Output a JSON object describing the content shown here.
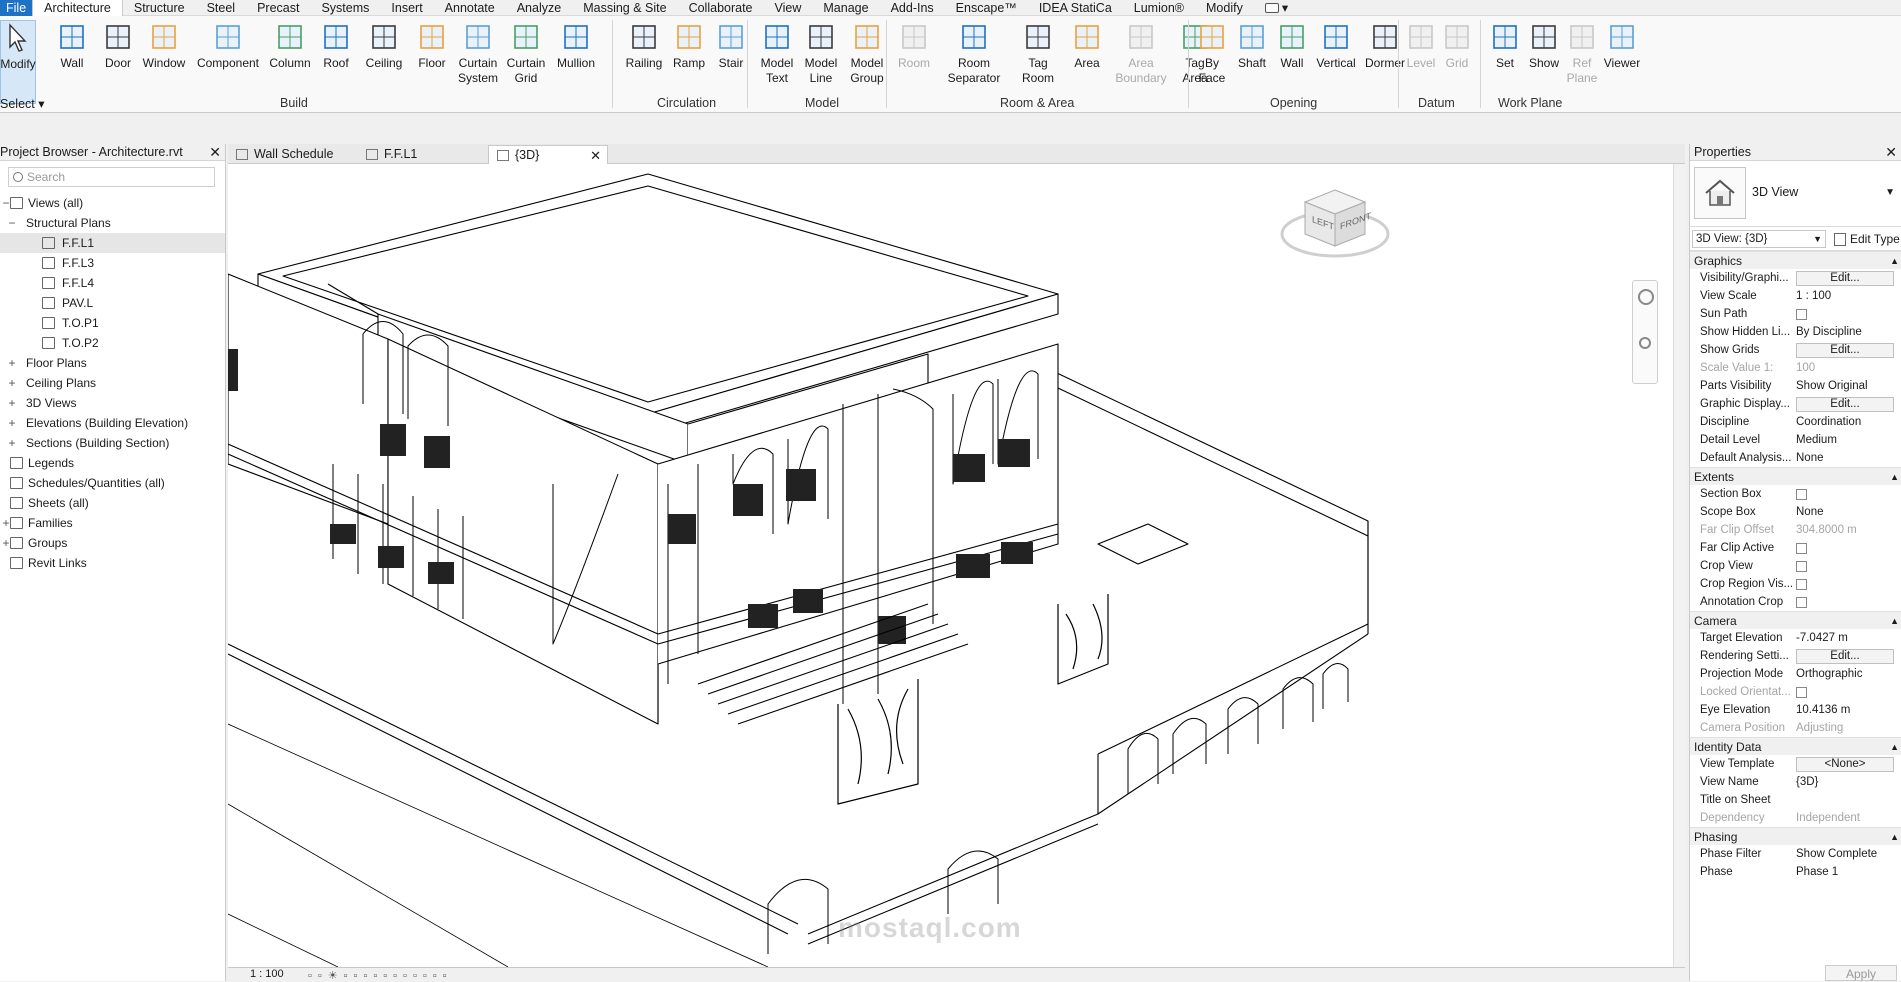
{
  "tabs": [
    "File",
    "Architecture",
    "Structure",
    "Steel",
    "Precast",
    "Systems",
    "Insert",
    "Annotate",
    "Analyze",
    "Massing & Site",
    "Collaborate",
    "View",
    "Manage",
    "Add-Ins",
    "Enscape™",
    "IDEA StatiCa",
    "Lumion®",
    "Modify"
  ],
  "active_tab": "Architecture",
  "ribbon": {
    "modify": "Modify",
    "select": "Select",
    "build": {
      "label": "Build",
      "tools": [
        "Wall",
        "Door",
        "Window",
        "Component",
        "Column",
        "Roof",
        "Ceiling",
        "Floor",
        "Curtain System",
        "Curtain Grid",
        "Mullion"
      ]
    },
    "circulation": {
      "label": "Circulation",
      "tools": [
        "Railing",
        "Ramp",
        "Stair"
      ]
    },
    "model": {
      "label": "Model",
      "tools": [
        "Model Text",
        "Model Line",
        "Model Group"
      ]
    },
    "room_area": {
      "label": "Room & Area",
      "tools": [
        "Room",
        "Room Separator",
        "Tag Room",
        "Area",
        "Area Boundary",
        "Tag Area"
      ]
    },
    "opening": {
      "label": "Opening",
      "tools": [
        "By Face",
        "Shaft",
        "Wall",
        "Vertical",
        "Dormer"
      ]
    },
    "datum": {
      "label": "Datum",
      "tools": [
        "Level",
        "Grid"
      ]
    },
    "work_plane": {
      "label": "Work Plane",
      "tools": [
        "Set",
        "Show",
        "Ref Plane",
        "Viewer"
      ]
    }
  },
  "browser": {
    "title": "Project Browser - Architecture.rvt",
    "search_placeholder": "Search",
    "items": [
      {
        "label": "Views (all)",
        "exp": "−",
        "indent": 0
      },
      {
        "label": "Structural Plans",
        "exp": "−",
        "indent": 1
      },
      {
        "label": "F.F.L1",
        "exp": "",
        "indent": 2,
        "selected": true
      },
      {
        "label": "F.F.L3",
        "exp": "",
        "indent": 2
      },
      {
        "label": "F.F.L4",
        "exp": "",
        "indent": 2
      },
      {
        "label": "PAV.L",
        "exp": "",
        "indent": 2
      },
      {
        "label": "T.O.P1",
        "exp": "",
        "indent": 2
      },
      {
        "label": "T.O.P2",
        "exp": "",
        "indent": 2
      },
      {
        "label": "Floor Plans",
        "exp": "+",
        "indent": 1
      },
      {
        "label": "Ceiling Plans",
        "exp": "+",
        "indent": 1
      },
      {
        "label": "3D Views",
        "exp": "+",
        "indent": 1
      },
      {
        "label": "Elevations (Building Elevation)",
        "exp": "+",
        "indent": 1
      },
      {
        "label": "Sections (Building Section)",
        "exp": "+",
        "indent": 1
      },
      {
        "label": "Legends",
        "exp": "",
        "indent": 0
      },
      {
        "label": "Schedules/Quantities (all)",
        "exp": "",
        "indent": 0
      },
      {
        "label": "Sheets (all)",
        "exp": "",
        "indent": 0
      },
      {
        "label": "Families",
        "exp": "+",
        "indent": 0
      },
      {
        "label": "Groups",
        "exp": "+",
        "indent": 0
      },
      {
        "label": "Revit Links",
        "exp": "",
        "indent": 0
      }
    ]
  },
  "view_tabs": [
    "Wall Schedule",
    "F.F.L1",
    "{3D}"
  ],
  "active_view": "{3D}",
  "view_scale": "1 : 100",
  "viewcube": {
    "left": "LEFT",
    "front": "FRONT"
  },
  "watermark": "mostaql.com",
  "properties": {
    "title": "Properties",
    "type_name": "3D View",
    "filter": "3D View: {3D}",
    "edit_type": "Edit Type",
    "apply": "Apply",
    "groups": [
      {
        "name": "Graphics",
        "rows": [
          {
            "n": "Visibility/Graphi...",
            "v": "Edit...",
            "kind": "button"
          },
          {
            "n": "View Scale",
            "v": "1 : 100"
          },
          {
            "n": "Sun Path",
            "v": "",
            "kind": "check"
          },
          {
            "n": "Show Hidden Li...",
            "v": "By Discipline"
          },
          {
            "n": "Show Grids",
            "v": "Edit...",
            "kind": "button"
          },
          {
            "n": "Scale Value    1:",
            "v": "100",
            "dis": true
          },
          {
            "n": "Parts Visibility",
            "v": "Show Original"
          },
          {
            "n": "Graphic Display...",
            "v": "Edit...",
            "kind": "button"
          },
          {
            "n": "Discipline",
            "v": "Coordination"
          },
          {
            "n": "Detail Level",
            "v": "Medium"
          },
          {
            "n": "Default Analysis...",
            "v": "None"
          }
        ]
      },
      {
        "name": "Extents",
        "rows": [
          {
            "n": "Section Box",
            "v": "",
            "kind": "check"
          },
          {
            "n": "Scope Box",
            "v": "None"
          },
          {
            "n": "Far Clip Offset",
            "v": "304.8000 m",
            "dis": true
          },
          {
            "n": "Far Clip Active",
            "v": "",
            "kind": "check"
          },
          {
            "n": "Crop View",
            "v": "",
            "kind": "check"
          },
          {
            "n": "Crop Region Vis...",
            "v": "",
            "kind": "check"
          },
          {
            "n": "Annotation Crop",
            "v": "",
            "kind": "check"
          }
        ]
      },
      {
        "name": "Camera",
        "rows": [
          {
            "n": "Target Elevation",
            "v": "-7.0427 m"
          },
          {
            "n": "Rendering Setti...",
            "v": "Edit...",
            "kind": "button"
          },
          {
            "n": "Projection Mode",
            "v": "Orthographic"
          },
          {
            "n": "Locked Orientat...",
            "v": "",
            "kind": "check",
            "dis": true
          },
          {
            "n": "Eye Elevation",
            "v": "10.4136 m"
          },
          {
            "n": "Camera Position",
            "v": "Adjusting",
            "dis": true
          }
        ]
      },
      {
        "name": "Identity Data",
        "rows": [
          {
            "n": "View Template",
            "v": "<None>",
            "kind": "button"
          },
          {
            "n": "View Name",
            "v": "{3D}"
          },
          {
            "n": "Title on Sheet",
            "v": ""
          },
          {
            "n": "Dependency",
            "v": "Independent",
            "dis": true
          }
        ]
      },
      {
        "name": "Phasing",
        "rows": [
          {
            "n": "Phase Filter",
            "v": "Show Complete"
          },
          {
            "n": "Phase",
            "v": "Phase 1"
          }
        ]
      }
    ]
  }
}
